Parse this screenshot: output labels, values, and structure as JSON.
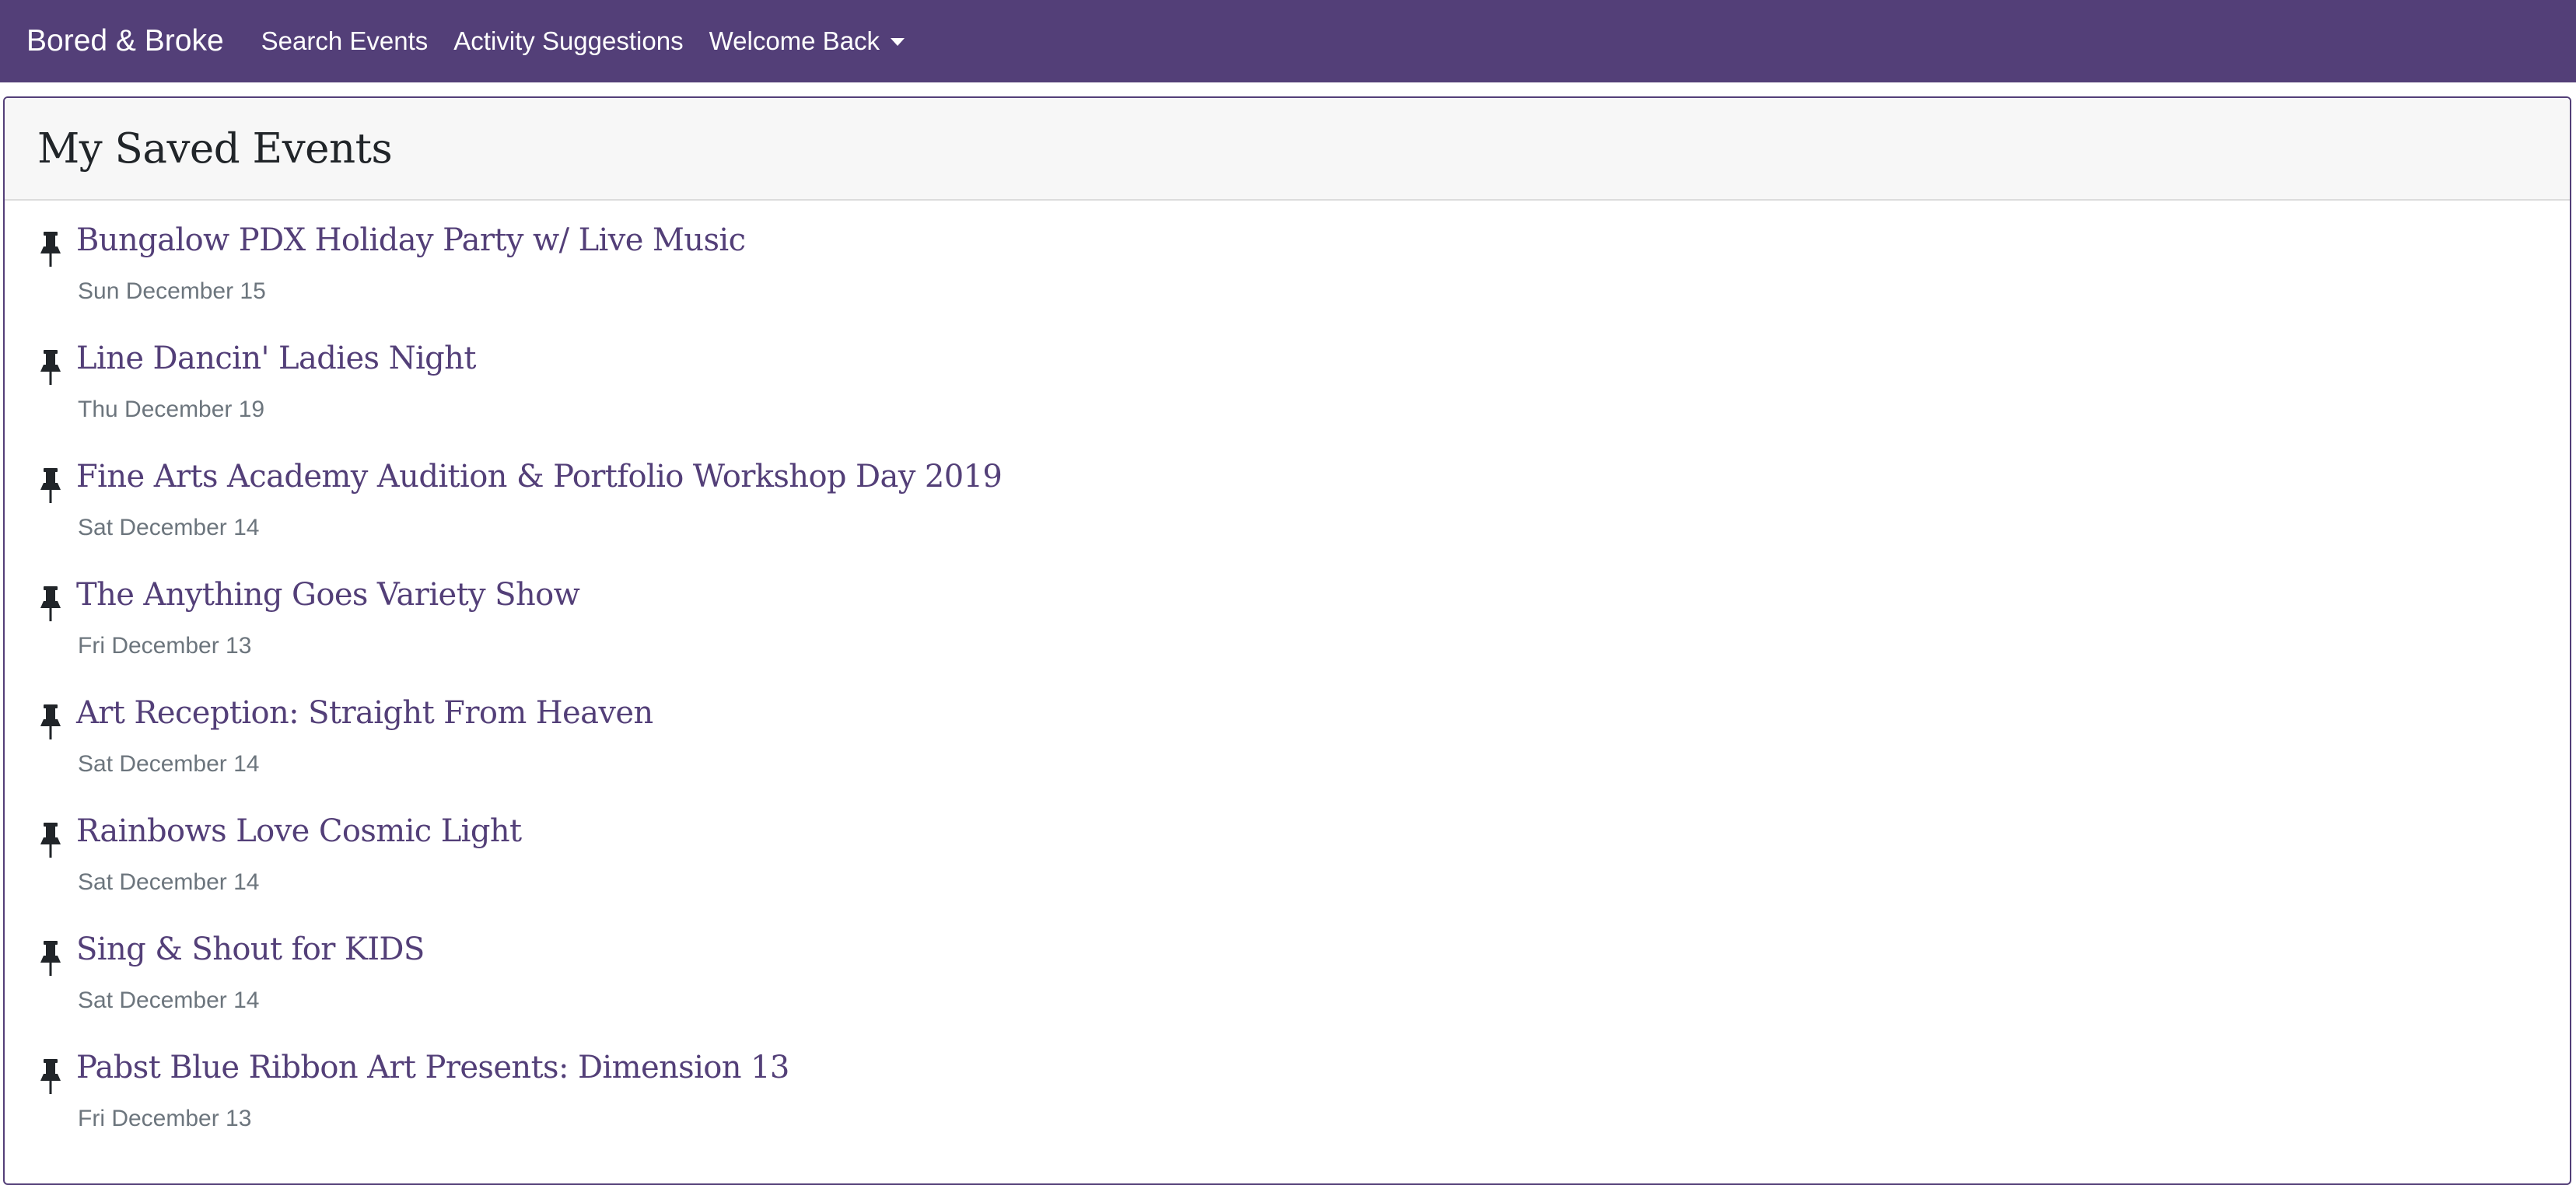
{
  "navbar": {
    "brand": "Bored & Broke",
    "links": [
      {
        "label": "Search Events"
      },
      {
        "label": "Activity Suggestions"
      },
      {
        "label": "Welcome Back"
      }
    ]
  },
  "page": {
    "title": "My Saved Events"
  },
  "events": [
    {
      "title": "Bungalow PDX Holiday Party w/ Live Music",
      "date": "Sun December 15",
      "icon": "pin-icon"
    },
    {
      "title": "Line Dancin' Ladies Night",
      "date": "Thu December 19",
      "icon": "pin-icon"
    },
    {
      "title": "Fine Arts Academy Audition & Portfolio Workshop Day 2019",
      "date": "Sat December 14",
      "icon": "pin-icon"
    },
    {
      "title": "The Anything Goes Variety Show",
      "date": "Fri December 13",
      "icon": "pin-icon"
    },
    {
      "title": "Art Reception: Straight From Heaven",
      "date": "Sat December 14",
      "icon": "pin-icon"
    },
    {
      "title": "Rainbows Love Cosmic Light",
      "date": "Sat December 14",
      "icon": "pin-icon"
    },
    {
      "title": "Sing & Shout for KIDS",
      "date": "Sat December 14",
      "icon": "pin-icon"
    },
    {
      "title": "Pabst Blue Ribbon Art Presents: Dimension 13",
      "date": "Fri December 13",
      "icon": "pin-icon"
    }
  ],
  "colors": {
    "navbar": "#533f78",
    "link": "#533f78",
    "muted": "#6c757d"
  }
}
